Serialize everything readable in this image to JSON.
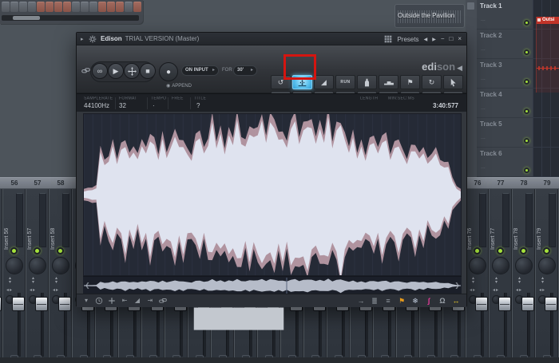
{
  "sequencer": {
    "steps": [
      "off",
      "off",
      "off",
      "off",
      "on",
      "on",
      "on",
      "on",
      "off",
      "off",
      "off",
      "on",
      "on",
      "on",
      "off",
      "on"
    ]
  },
  "clip": {
    "label": "Outside the Pavilion"
  },
  "playlist": {
    "tracks": [
      "Track 1",
      "Track 2",
      "Track 3",
      "Track 4",
      "Track 5",
      "Track 6"
    ],
    "row_dots": "...",
    "red_clip_label": "Outsi"
  },
  "edison": {
    "title_app": "Edison",
    "title_rest": "TRIAL VERSION (Master)",
    "presets_label": "Presets",
    "logo_a": "edi",
    "logo_b": "son",
    "transport": {
      "on_input": "ON INPUT",
      "for_label": "FOR",
      "duration": "30'",
      "append_label": "APPEND"
    },
    "run_label": "RUN",
    "info": {
      "samplerate_label": "SAMPLERATE",
      "samplerate_value": "44100Hz",
      "format_label": "FORMAT",
      "format_value": "32",
      "tempo_label": "TEMPO",
      "tempo_value": "·",
      "free_label": "FREE",
      "title_label": "TITLE",
      "title_value": "?",
      "length_label": "LENGTH",
      "units_label": "MIN:SEC:MS",
      "length_value": "3:40:577"
    },
    "tool_grid": {
      "row1": [
        {
          "name": "turn-button",
          "icon": "turn-icon"
        },
        {
          "name": "normalize-button",
          "icon": "normalize-icon",
          "active": true
        },
        {
          "name": "fade-in-button",
          "icon": "fade-in-icon"
        },
        {
          "name": "run-script-button",
          "icon": "run-icon"
        },
        {
          "name": "declip-button",
          "icon": "bottle-icon"
        },
        {
          "name": "eq-button",
          "icon": "bars-icon"
        },
        {
          "name": "add-marker-button",
          "icon": "flag-icon"
        },
        {
          "name": "convolution-button",
          "icon": "refresh-icon"
        },
        {
          "name": "paste-tool-button",
          "icon": "cursor-icon"
        }
      ],
      "row2": [
        {
          "name": "articulator-button",
          "icon": "person-icon"
        },
        {
          "name": "time-stretch-button",
          "icon": "stretch-icon"
        },
        {
          "name": "fade-out-button",
          "icon": "fade-out-icon"
        },
        {
          "name": "clock-button",
          "icon": "clock-icon"
        },
        {
          "name": "blur-button",
          "icon": "drop-icon"
        },
        {
          "name": "draw-button",
          "icon": "pencil-icon"
        },
        {
          "name": "select-flag-button",
          "icon": "flag-outline-icon"
        },
        {
          "name": "save-sample-button",
          "icon": "save-arrow-icon"
        },
        {
          "name": "send-to-playlist-button",
          "icon": "monitor-icon"
        }
      ]
    },
    "file_row": [
      {
        "name": "save-button",
        "icon": "floppy-icon"
      },
      {
        "name": "copy-button",
        "icon": "page-icon"
      },
      {
        "name": "divider-1",
        "icon": "divider"
      },
      {
        "name": "cut-button",
        "icon": "scissors-icon"
      },
      {
        "name": "tools-button",
        "icon": "wrench-icon"
      },
      {
        "name": "region-button",
        "icon": "flag-icon"
      },
      {
        "name": "divider-2",
        "icon": "divider"
      },
      {
        "name": "preview-button",
        "icon": "eye-icon"
      },
      {
        "name": "monitor-button",
        "icon": "headphones-icon"
      },
      {
        "name": "loop-button",
        "icon": "loop-icon"
      },
      {
        "name": "zoom-button",
        "icon": "magnify-icon"
      }
    ],
    "bottom_left_row": [
      {
        "name": "options-menu",
        "icon": "menu-down-icon"
      },
      {
        "name": "snap-button",
        "icon": "clock-icon"
      },
      {
        "name": "center-button",
        "icon": "plus-icon"
      },
      {
        "name": "prev-marker-button",
        "icon": "prev-marker-icon"
      },
      {
        "name": "ramp-button",
        "icon": "fade-in-icon"
      },
      {
        "name": "next-marker-button",
        "icon": "next-marker-icon"
      },
      {
        "name": "link-button",
        "icon": "link-icon"
      }
    ],
    "bottom_right_row": [
      {
        "name": "jump-button",
        "icon": "arrow-right-icon",
        "color": "#9aa1a9"
      },
      {
        "name": "list-button",
        "icon": "list-icon",
        "color": "#8f969e"
      },
      {
        "name": "list-alt-button",
        "icon": "list2-icon",
        "color": "#8f969e"
      },
      {
        "name": "marker-button",
        "icon": "flag-icon",
        "color": "#e89b1c"
      },
      {
        "name": "freeze-button",
        "icon": "snowflake-icon",
        "color": "#c2cddd"
      },
      {
        "name": "smooth-button",
        "icon": "scurve-icon",
        "color": "#e83a9a"
      },
      {
        "name": "magnet-button",
        "icon": "magnet-icon",
        "color": "#9aa1a9"
      },
      {
        "name": "stretch-lr-button",
        "icon": "swap-icon",
        "color": "#f0d02a"
      }
    ]
  },
  "mixer": {
    "left_channels": [
      {
        "number": "56",
        "label": "Insert 56"
      },
      {
        "number": "57",
        "label": "Insert 57"
      },
      {
        "number": "58",
        "label": "Insert 58"
      }
    ],
    "right_channels": [
      {
        "number": "76",
        "label": "Insert 76"
      },
      {
        "number": "77",
        "label": "Insert 77"
      },
      {
        "number": "78",
        "label": "Insert 78"
      },
      {
        "number": "79",
        "label": "Insert 79"
      }
    ]
  },
  "waveform": {
    "envelope": [
      0.04,
      0.05,
      0.06,
      0.07,
      0.55,
      0.35,
      0.45,
      0.62,
      0.4,
      0.52,
      0.66,
      0.45,
      0.56,
      0.4,
      0.62,
      0.5,
      0.72,
      0.55,
      0.45,
      0.66,
      0.5,
      0.6,
      0.76,
      0.55,
      0.66,
      0.5,
      0.45,
      0.6,
      0.72,
      0.5,
      0.66,
      0.8,
      0.6,
      0.72,
      0.55,
      0.76,
      0.65,
      0.86,
      0.7,
      0.6,
      0.8,
      0.65,
      0.76,
      0.9,
      0.7,
      0.8,
      0.86,
      0.65,
      0.76,
      0.6,
      0.86,
      0.85,
      0.7,
      0.8,
      0.9,
      0.75,
      0.65,
      0.8,
      0.7,
      0.86,
      0.6,
      0.76,
      0.95,
      0.7,
      0.55,
      0.66,
      0.5,
      0.6,
      0.45,
      0.56,
      0.66,
      0.5,
      0.7,
      0.6,
      0.45,
      0.55,
      0.66,
      0.5,
      0.4,
      0.5,
      0.6,
      0.45,
      0.55,
      0.35,
      0.45,
      0.5,
      0.4,
      0.3,
      0.36,
      0.16,
      0.08,
      0.04
    ]
  },
  "colors": {
    "highlight_blue": "#5fc3ee",
    "alert_red": "#d41510",
    "led_green": "#a5e23a"
  }
}
